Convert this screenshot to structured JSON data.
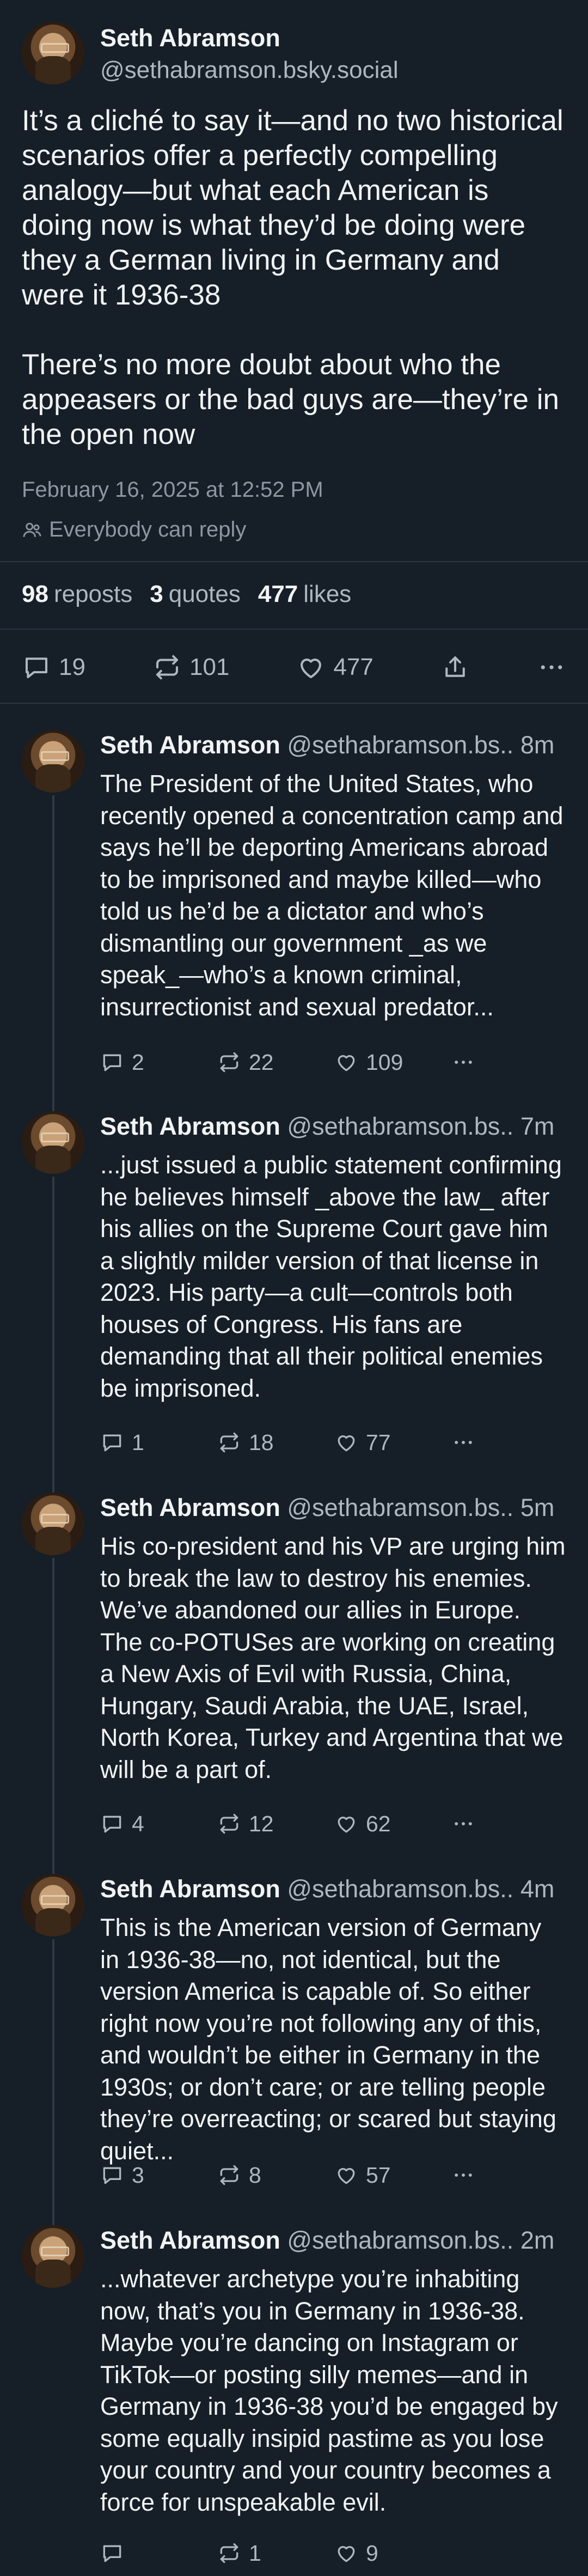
{
  "post": {
    "author_name": "Seth Abramson",
    "handle": "@sethabramson.bsky.social",
    "body": "It’s a cliché to say it—and no two historical scenarios offer a perfectly compelling analogy—but what each American is doing now is what they’d be doing were they a German living in Germany and were it 1936-38\n\nThere’s no more doubt about who the appeasers or the bad guys are—they’re in the open now",
    "timestamp": "February 16, 2025 at 12:52 PM",
    "reply_setting": "Everybody can reply",
    "reposts_count": "98",
    "reposts_label": "reposts",
    "quotes_count": "3",
    "quotes_label": "quotes",
    "likes_count": "477",
    "likes_label": "likes",
    "actions": {
      "replies": "19",
      "reposts": "101",
      "likes": "477"
    }
  },
  "replies": [
    {
      "author_name": "Seth Abramson",
      "handle": "@sethabramson.bs..",
      "time": "8m",
      "body": "The President of the United States, who recently opened a concentration camp and says he’ll be deporting Americans abroad to be imprisoned and maybe killed—who told us he’d be a dictator and who’s dismantling our government _as we speak_—who’s a known criminal, insurrectionist and sexual predator...",
      "replies": "2",
      "reposts": "22",
      "likes": "109"
    },
    {
      "author_name": "Seth Abramson",
      "handle": "@sethabramson.bs..",
      "time": "7m",
      "body": "...just issued a public statement confirming he believes himself _above the law_ after his allies on the Supreme Court gave him a slightly milder version of that license in 2023. His party—a cult—controls both houses of Congress. His fans are demanding that all their political enemies be imprisoned.",
      "replies": "1",
      "reposts": "18",
      "likes": "77"
    },
    {
      "author_name": "Seth Abramson",
      "handle": "@sethabramson.bs..",
      "time": "5m",
      "body": "His co-president and his VP are urging him to break the law to destroy his enemies. We’ve abandoned our allies in Europe. The co-POTUSes are working on creating a New Axis of Evil with Russia, China, Hungary, Saudi Arabia, the UAE, Israel, North Korea, Turkey and Argentina that we will be a part of.",
      "replies": "4",
      "reposts": "12",
      "likes": "62"
    },
    {
      "author_name": "Seth Abramson",
      "handle": "@sethabramson.bs..",
      "time": "4m",
      "body": "This is the American version of Germany in 1936-38—no, not identical, but the version America is capable of. So either right now you’re not following any of this, and wouldn’t be either in Germany in the 1930s; or don’t care; or are telling people they’re overreacting; or scared but staying quiet...",
      "replies": "3",
      "reposts": "8",
      "likes": "57"
    },
    {
      "author_name": "Seth Abramson",
      "handle": "@sethabramson.bs..",
      "time": "2m",
      "body": "...whatever archetype you’re inhabiting now, that’s you in Germany in 1936-38. Maybe you’re dancing on Instagram or TikTok—or posting silly memes—and in Germany in 1936-38 you’d be engaged by some equally insipid pastime as you lose your country and your country becomes a force for unspeakable evil.",
      "replies": "",
      "reposts": "1",
      "likes": "9"
    }
  ]
}
